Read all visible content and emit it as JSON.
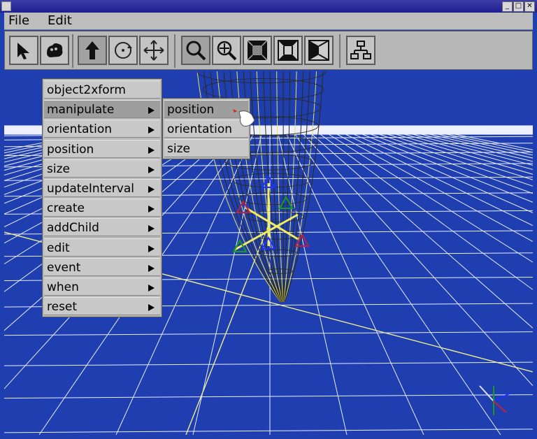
{
  "menubar": {
    "file": "File",
    "edit": "Edit"
  },
  "window_controls": [
    "_",
    "□",
    "✕"
  ],
  "toolbar": {
    "buttons": [
      {
        "icon": "select-arrow-icon"
      },
      {
        "icon": "pick-hand-icon"
      },
      {
        "icon": "translate-up-icon"
      },
      {
        "icon": "rotate-icon"
      },
      {
        "icon": "move-cross-icon"
      },
      {
        "icon": "view-magnifier-icon"
      },
      {
        "icon": "zoom-icon"
      },
      {
        "icon": "view-front-icon"
      },
      {
        "icon": "view-perspective-icon"
      },
      {
        "icon": "view-side-icon"
      },
      {
        "icon": "scene-tree-icon"
      }
    ]
  },
  "context_menu": {
    "items": [
      {
        "label": "object2xform",
        "submenu": false
      },
      {
        "label": "manipulate",
        "submenu": true
      },
      {
        "label": "orientation",
        "submenu": true
      },
      {
        "label": "position",
        "submenu": true
      },
      {
        "label": "size",
        "submenu": true
      },
      {
        "label": "updateInterval",
        "submenu": true
      },
      {
        "label": "create",
        "submenu": true
      },
      {
        "label": "addChild",
        "submenu": true
      },
      {
        "label": "edit",
        "submenu": true
      },
      {
        "label": "event",
        "submenu": true
      },
      {
        "label": "when",
        "submenu": true
      },
      {
        "label": "reset",
        "submenu": true
      }
    ]
  },
  "submenu": {
    "items": [
      {
        "label": "position",
        "highlighted": true
      },
      {
        "label": "orientation",
        "highlighted": false
      },
      {
        "label": "size",
        "highlighted": false
      }
    ]
  },
  "colors": {
    "viewport_bg": "#1f3fb0",
    "grid": "#e8ecff",
    "wire_dark": "#2a2a1a",
    "wire_yellow": "#e8e060"
  }
}
